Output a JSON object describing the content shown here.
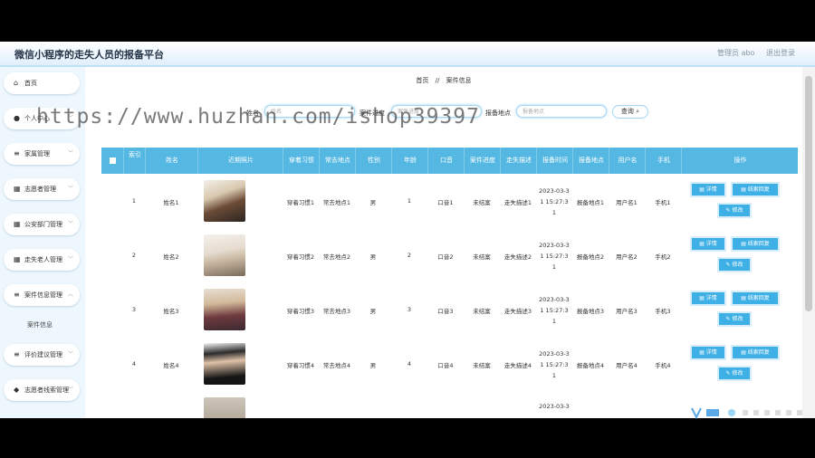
{
  "app": {
    "title": "微信小程序的走失人员的报备平台"
  },
  "user": {
    "name": "管理员 abo",
    "logout": "退出登录"
  },
  "sidebar": {
    "items": [
      {
        "label": "首页",
        "icon": "home-icon",
        "glyph": "⌂"
      },
      {
        "label": "个人中心",
        "icon": "person-icon",
        "glyph": "●"
      },
      {
        "label": "家属管理",
        "icon": "list-icon",
        "glyph": "≡"
      },
      {
        "label": "志愿者管理",
        "icon": "grid-icon",
        "glyph": "▦"
      },
      {
        "label": "公安部门管理",
        "icon": "grid-icon",
        "glyph": "▦"
      },
      {
        "label": "走失老人管理",
        "icon": "grid-icon",
        "glyph": "▦"
      },
      {
        "label": "案件信息管理",
        "icon": "list-icon",
        "glyph": "≡"
      },
      {
        "label": "评价建议管理",
        "icon": "list-icon",
        "glyph": "≡"
      },
      {
        "label": "志愿者线索管理",
        "icon": "location-icon",
        "glyph": "◆"
      }
    ],
    "subitem": "案件信息"
  },
  "breadcrumb": {
    "home": "首页",
    "sep": "//",
    "current": "案件信息"
  },
  "search": {
    "name_label": "姓名",
    "name_placeholder": "姓名",
    "progress_label": "案件进度",
    "progress_placeholder": "案件进度",
    "location_label": "报备地点",
    "location_placeholder": "报备地点",
    "button": "查询"
  },
  "table": {
    "headers": [
      "索引",
      "姓名",
      "近期照片",
      "穿着习惯",
      "常去地点",
      "性别",
      "年龄",
      "口音",
      "案件进度",
      "走失描述",
      "报备时间",
      "报备地点",
      "用户名",
      "手机",
      "操作"
    ],
    "rows": [
      {
        "index": "1",
        "name": "姓名1",
        "habit": "穿着习惯1",
        "place": "常去地点1",
        "gender": "男",
        "age": "1",
        "accent": "口音1",
        "progress": "未结案",
        "desc": "走失描述1",
        "time_a": "2023-03-3",
        "time_b": "1 15:27:3",
        "time_c": "1",
        "location": "报备地点1",
        "username": "用户名1",
        "phone": "手机1"
      },
      {
        "index": "2",
        "name": "姓名2",
        "habit": "穿着习惯2",
        "place": "常去地点2",
        "gender": "男",
        "age": "2",
        "accent": "口音2",
        "progress": "未结案",
        "desc": "走失描述2",
        "time_a": "2023-03-3",
        "time_b": "1 15:27:3",
        "time_c": "1",
        "location": "报备地点2",
        "username": "用户名2",
        "phone": "手机2"
      },
      {
        "index": "3",
        "name": "姓名3",
        "habit": "穿着习惯3",
        "place": "常去地点3",
        "gender": "男",
        "age": "3",
        "accent": "口音3",
        "progress": "未结案",
        "desc": "走失描述3",
        "time_a": "2023-03-3",
        "time_b": "1 15:27:3",
        "time_c": "1",
        "location": "报备地点3",
        "username": "用户名3",
        "phone": "手机3"
      },
      {
        "index": "4",
        "name": "姓名4",
        "habit": "穿着习惯4",
        "place": "常去地点4",
        "gender": "男",
        "age": "4",
        "accent": "口音4",
        "progress": "未结案",
        "desc": "走失描述4",
        "time_a": "2023-03-3",
        "time_b": "1 15:27:3",
        "time_c": "1",
        "location": "报备地点4",
        "username": "用户名4",
        "phone": "手机4"
      }
    ],
    "partial_time": "2023-03-3",
    "actions": {
      "detail": "详情",
      "clue": "线索回复",
      "edit": "修改"
    }
  },
  "watermark": "https://www.huzhan.com/ishop39397",
  "colors": {
    "accent": "#55b8e3",
    "button": "#3fb0e6",
    "sidebar_bg": "#eef7fd"
  }
}
